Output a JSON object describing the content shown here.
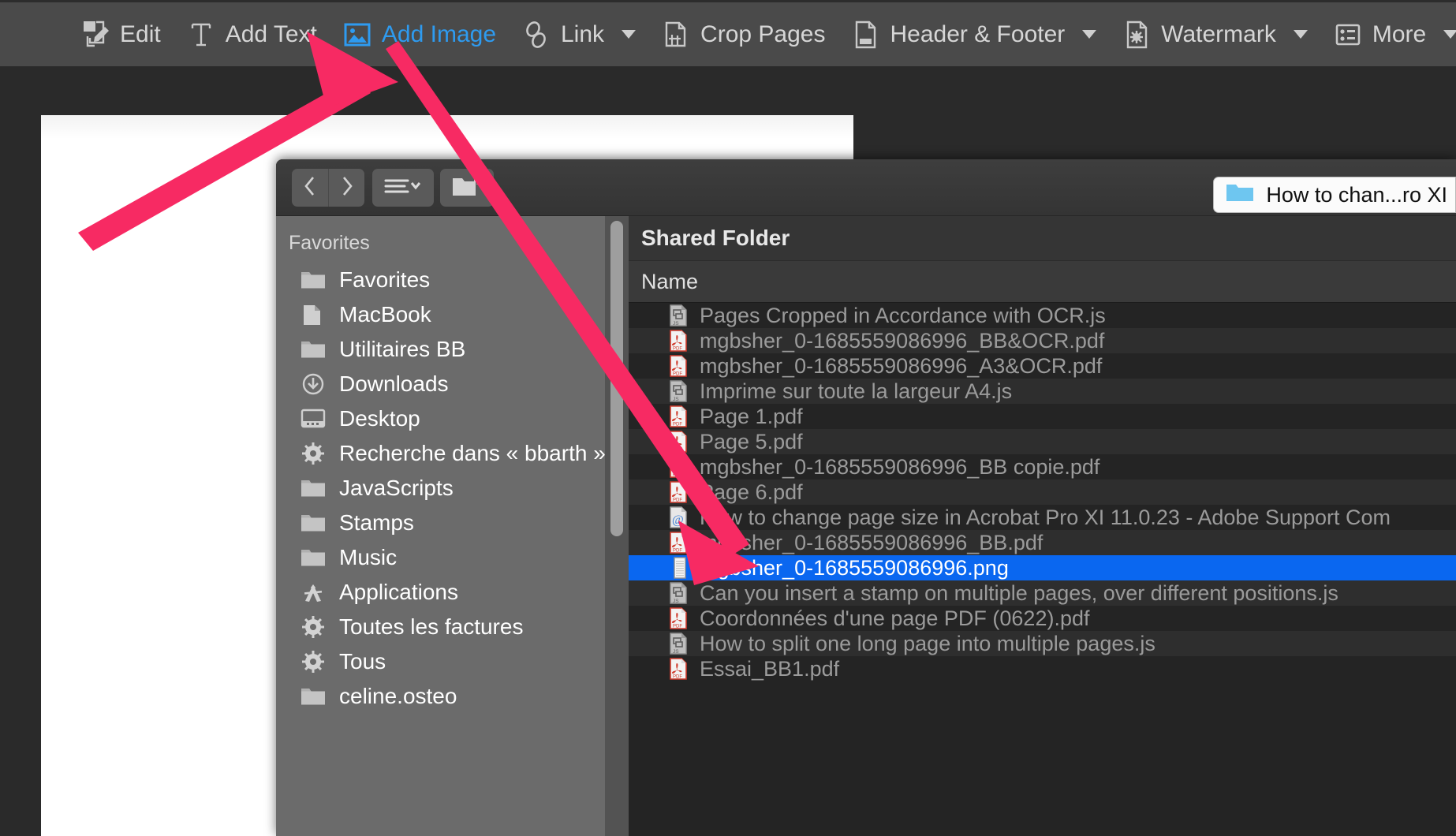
{
  "toolbar": {
    "items": [
      {
        "label": "Edit",
        "icon": "edit-pages-icon",
        "active": false,
        "caret": false
      },
      {
        "label": "Add Text",
        "icon": "add-text-icon",
        "active": false,
        "caret": false
      },
      {
        "label": "Add Image",
        "icon": "add-image-icon",
        "active": true,
        "caret": false
      },
      {
        "label": "Link",
        "icon": "link-icon",
        "active": false,
        "caret": true
      },
      {
        "label": "Crop Pages",
        "icon": "crop-pages-icon",
        "active": false,
        "caret": false
      },
      {
        "label": "Header & Footer",
        "icon": "header-footer-icon",
        "active": false,
        "caret": true
      },
      {
        "label": "Watermark",
        "icon": "watermark-icon",
        "active": false,
        "caret": true
      },
      {
        "label": "More",
        "icon": "more-list-icon",
        "active": false,
        "caret": true
      }
    ]
  },
  "dialog": {
    "nav": {
      "back_icon": "chevron-left-icon",
      "forward_icon": "chevron-right-icon",
      "view_icon": "list-view-icon",
      "new_folder_icon": "new-folder-icon"
    },
    "path_selector": {
      "label": "How to chan...ro XI",
      "icon": "blue-folder-icon"
    },
    "sidebar": {
      "header": "Favorites",
      "items": [
        {
          "label": "Favorites",
          "icon": "folder-icon"
        },
        {
          "label": "MacBook",
          "icon": "document-icon"
        },
        {
          "label": "Utilitaires BB",
          "icon": "folder-icon"
        },
        {
          "label": "Downloads",
          "icon": "download-icon"
        },
        {
          "label": "Desktop",
          "icon": "desktop-icon"
        },
        {
          "label": "Recherche dans « bbarth »",
          "icon": "gear-icon"
        },
        {
          "label": "JavaScripts",
          "icon": "folder-icon"
        },
        {
          "label": "Stamps",
          "icon": "folder-icon"
        },
        {
          "label": "Music",
          "icon": "folder-icon"
        },
        {
          "label": "Applications",
          "icon": "applications-icon"
        },
        {
          "label": "Toutes les factures",
          "icon": "gear-icon"
        },
        {
          "label": "Tous",
          "icon": "gear-icon"
        },
        {
          "label": "celine.osteo",
          "icon": "folder-icon"
        }
      ]
    },
    "filepane": {
      "title": "Shared Folder",
      "column_header": "Name",
      "rows": [
        {
          "name": "Pages Cropped in Accordance with OCR.js",
          "icon": "js-file-icon",
          "selected": false
        },
        {
          "name": "mgbsher_0-1685559086996_BB&OCR.pdf",
          "icon": "pdf-file-icon",
          "selected": false
        },
        {
          "name": "mgbsher_0-1685559086996_A3&OCR.pdf",
          "icon": "pdf-file-icon",
          "selected": false
        },
        {
          "name": "Imprime sur toute la largeur A4.js",
          "icon": "js-file-icon",
          "selected": false
        },
        {
          "name": "Page 1.pdf",
          "icon": "pdf-file-icon",
          "selected": false
        },
        {
          "name": "Page 5.pdf",
          "icon": "pdf-file-icon",
          "selected": false
        },
        {
          "name": "mgbsher_0-1685559086996_BB copie.pdf",
          "icon": "pdf-file-icon",
          "selected": false
        },
        {
          "name": "Page 6.pdf",
          "icon": "pdf-file-icon",
          "selected": false
        },
        {
          "name": "How to change page size in Acrobat Pro XI 11.0.23 - Adobe Support Com",
          "icon": "webloc-icon",
          "selected": false
        },
        {
          "name": "mgbsher_0-1685559086996_BB.pdf",
          "icon": "pdf-file-icon",
          "selected": false
        },
        {
          "name": "mgbsher_0-1685559086996.png",
          "icon": "image-file-icon",
          "selected": true
        },
        {
          "name": "Can you insert a stamp on multiple pages, over different positions.js",
          "icon": "js-file-icon",
          "selected": false
        },
        {
          "name": "Coordonnées d'une page PDF (0622).pdf",
          "icon": "pdf-file-icon",
          "selected": false
        },
        {
          "name": "How to split one long page into multiple pages.js",
          "icon": "js-file-icon",
          "selected": false
        },
        {
          "name": "Essai_BB1.pdf",
          "icon": "pdf-file-icon",
          "selected": false
        }
      ]
    }
  },
  "annotations": {
    "arrow_color": "#f72a63",
    "arrows": [
      {
        "name": "arrow-to-add-image-button"
      },
      {
        "name": "arrow-to-selected-png-file"
      }
    ]
  },
  "colors": {
    "accent_blue": "#2e9bf0",
    "selection_blue": "#0a67f0",
    "toolbar_bg": "#4a4a4a",
    "sidebar_bg": "#6b6b6b",
    "filepane_bg": "#242424",
    "arrow_pink": "#f72a63"
  }
}
